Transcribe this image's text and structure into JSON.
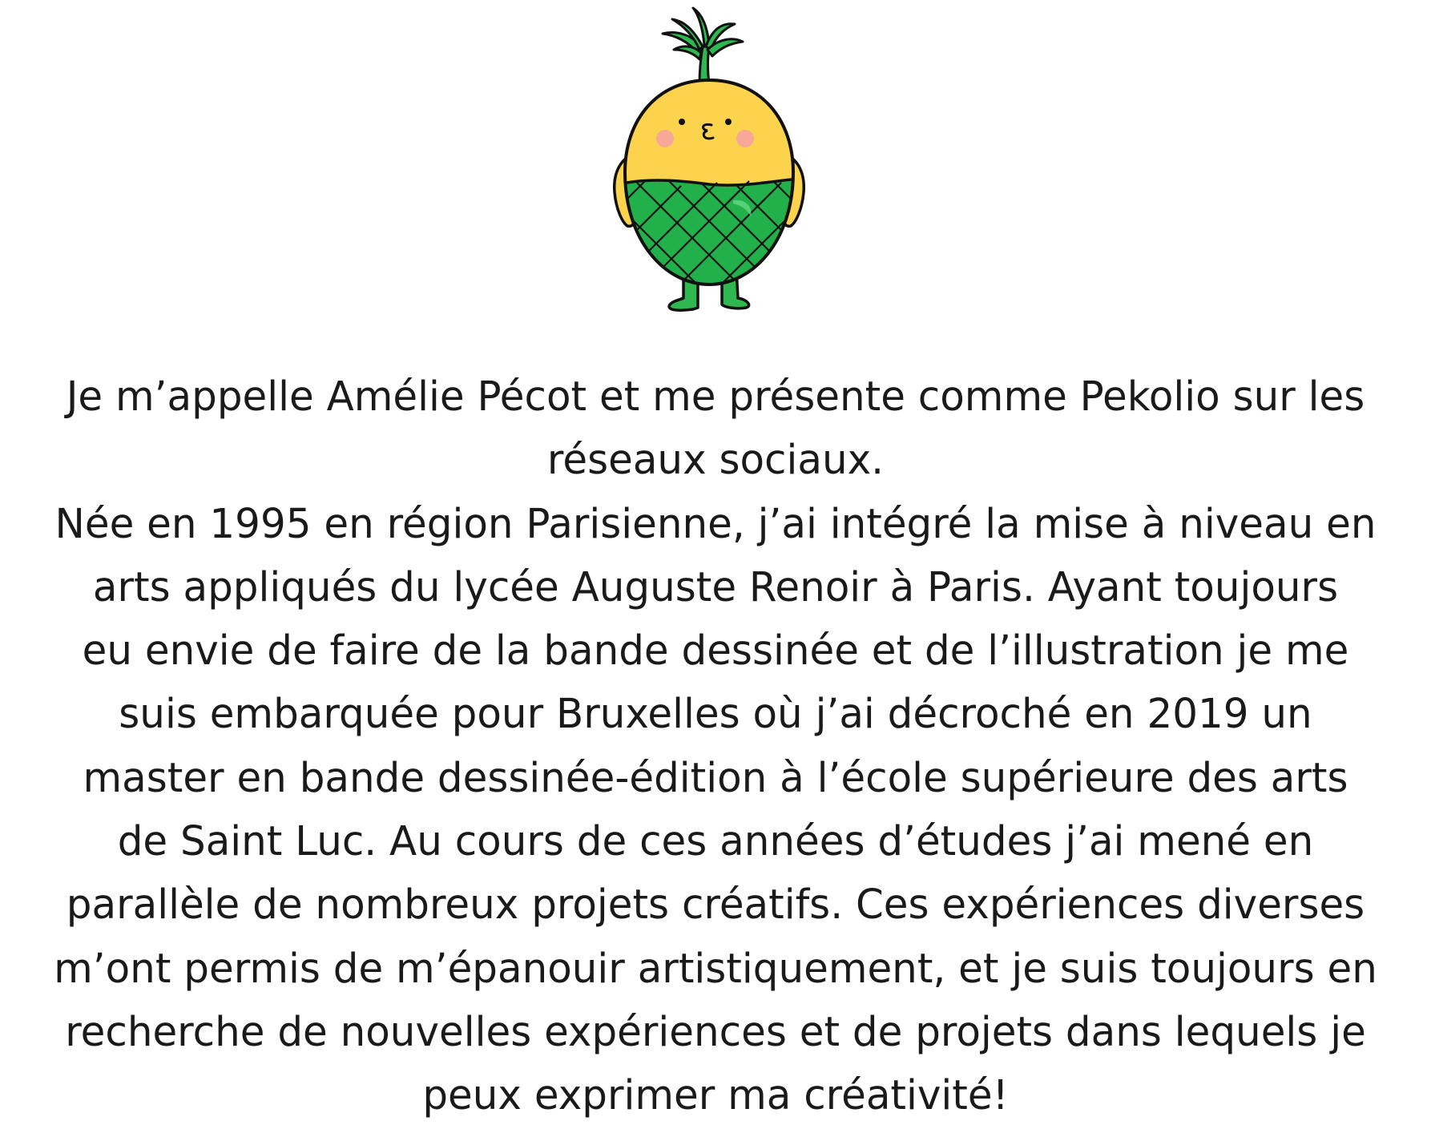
{
  "colors": {
    "background": "#ffffff",
    "text": "#1a1a1a",
    "pineapple_yellow": "#fcd34d",
    "pineapple_green": "#22b04b",
    "leaf_green": "#2eb84f",
    "cheek_pink": "#f7a3a0",
    "outline": "#111111"
  },
  "mascot": {
    "icon": "pineapple-character-icon"
  },
  "bio": {
    "lines": [
      "Je m’appelle Amélie Pécot et me présente comme Pekolio sur les",
      "réseaux sociaux.",
      "Née en 1995 en région Parisienne, j’ai intégré la mise à niveau en",
      "arts appliqués du lycée Auguste Renoir à Paris. Ayant toujours",
      "eu envie de faire de la bande dessinée et de l’illustration je me",
      "suis embarquée pour Bruxelles où j’ai décroché en 2019 un",
      "master en bande dessinée-édition à l’école supérieure des arts",
      "de Saint Luc. Au cours de ces années d’études j’ai mené en",
      "parallèle de nombreux projets créatifs. Ces expériences diverses",
      "m’ont permis de m’épanouir artistiquement, et je suis toujours en",
      "recherche de nouvelles expériences et de projets dans lequels je",
      "peux exprimer ma créativité!"
    ]
  }
}
